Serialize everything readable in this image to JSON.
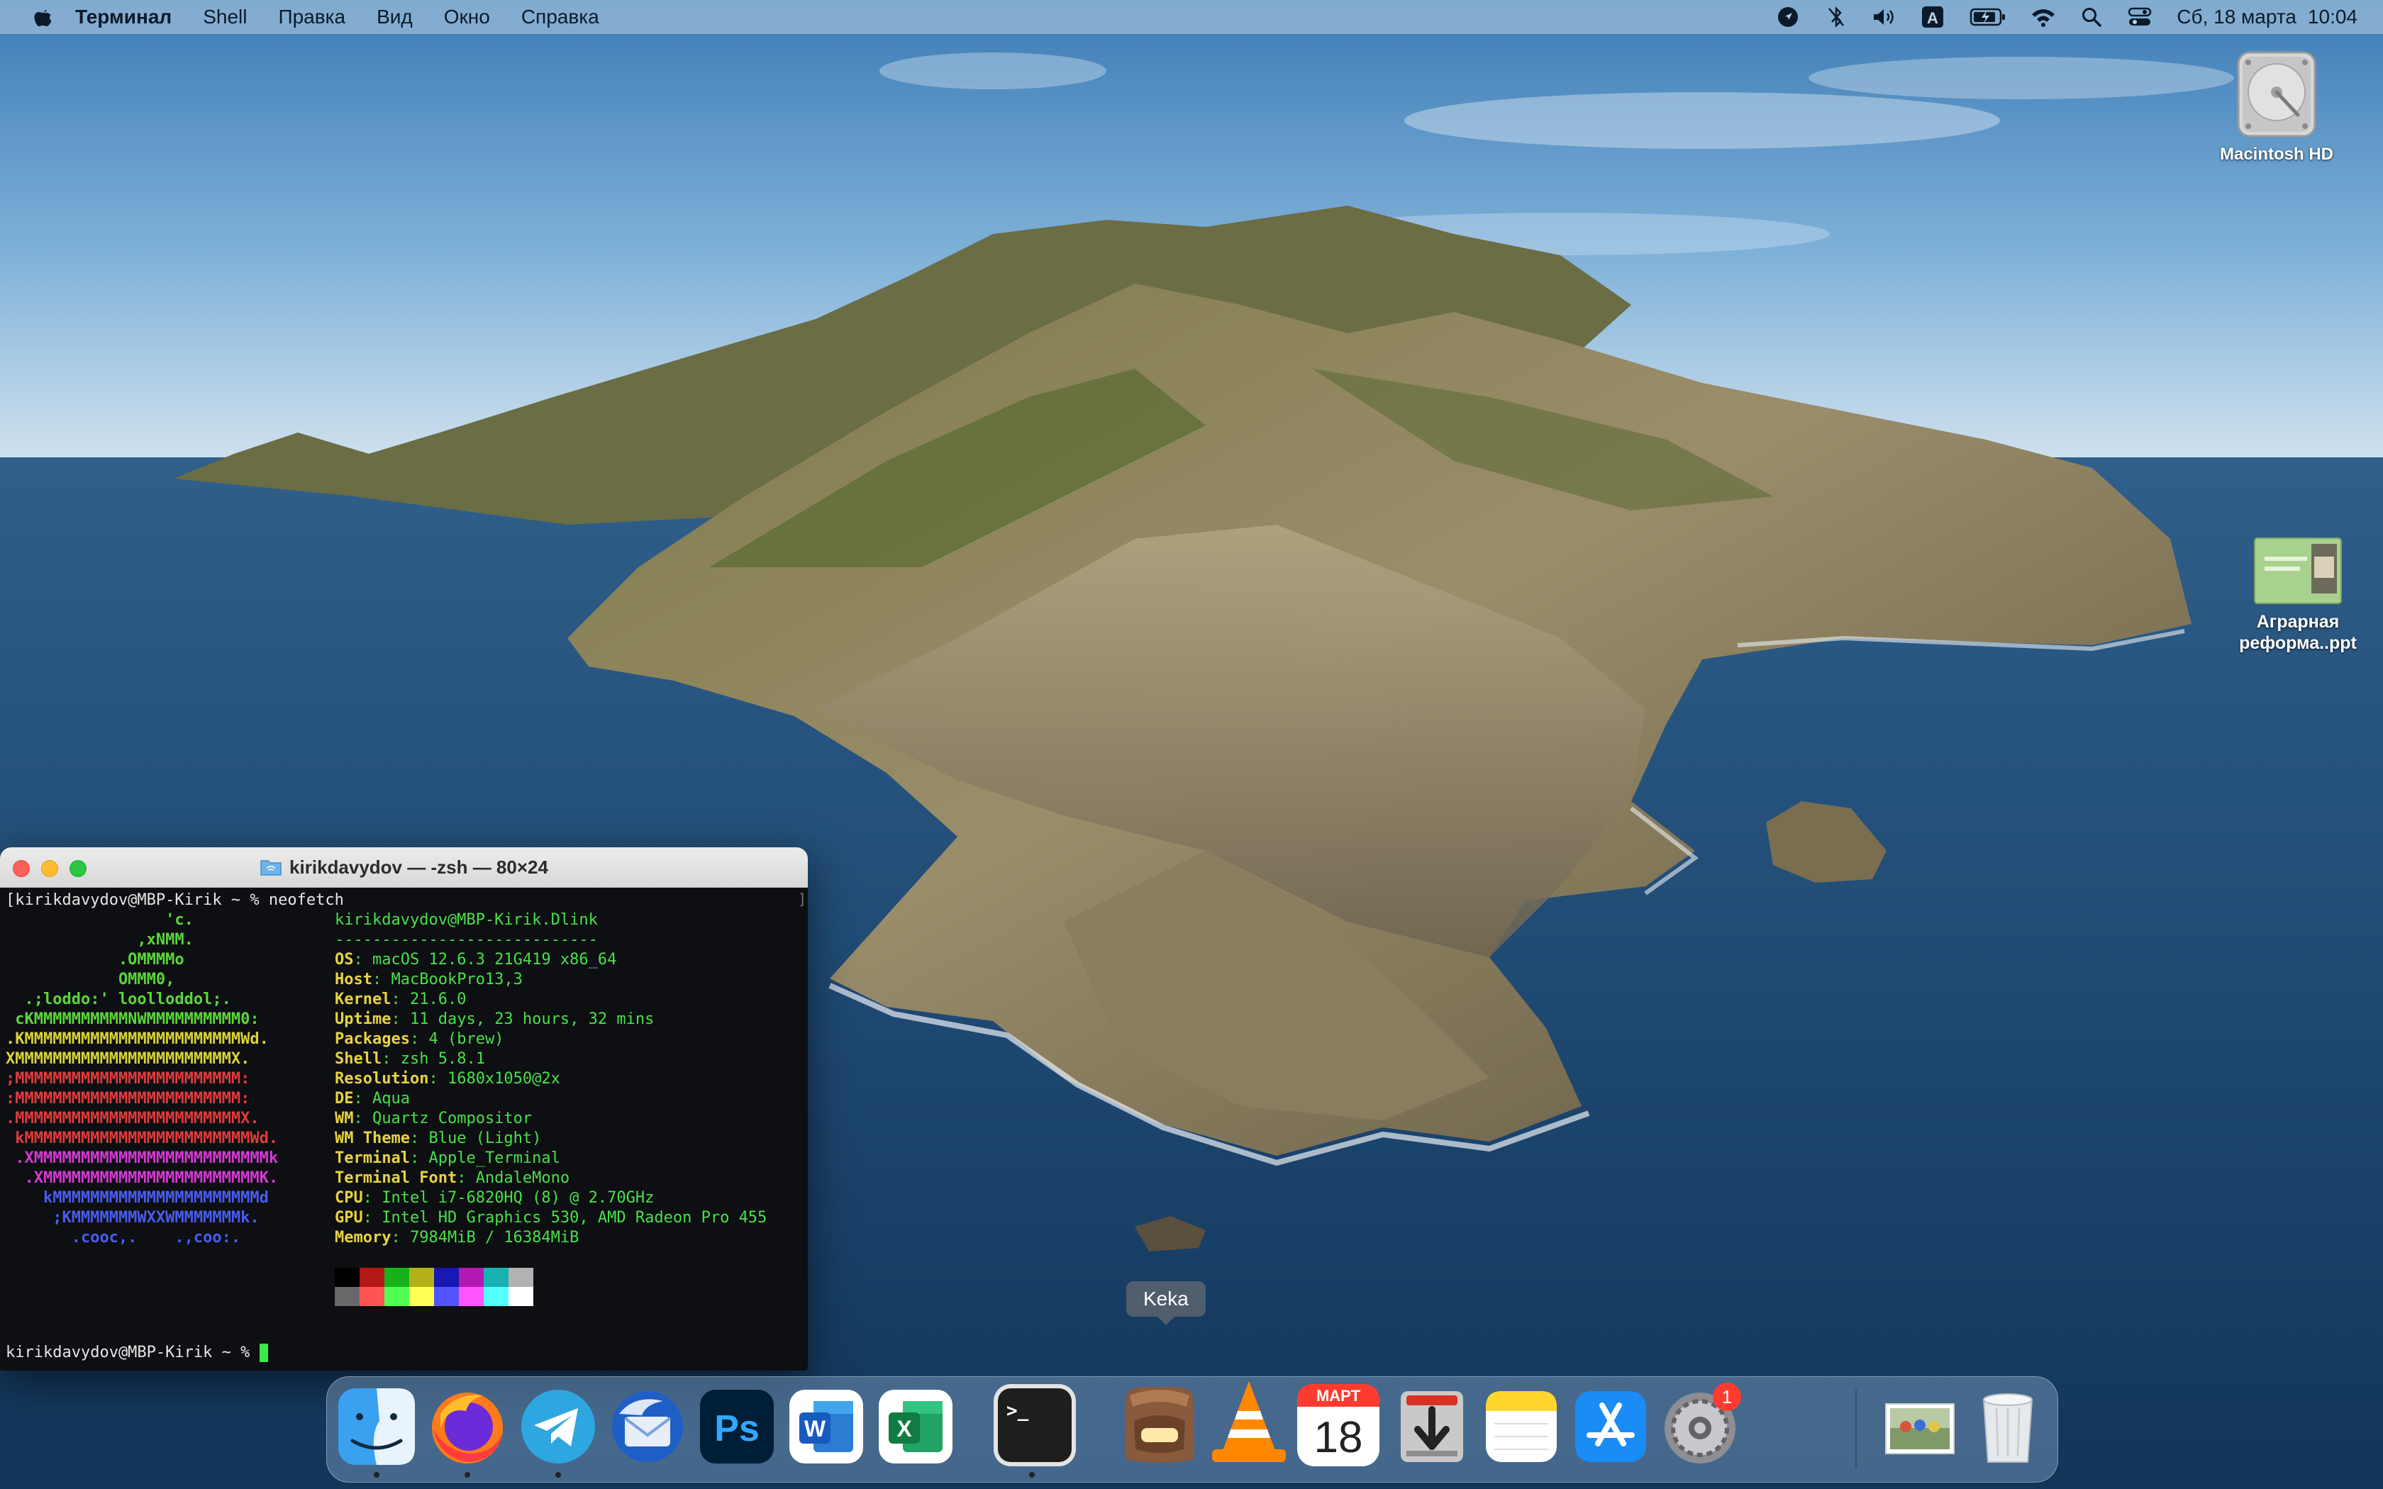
{
  "menubar": {
    "app_name": "Терминал",
    "items": [
      "Shell",
      "Правка",
      "Вид",
      "Окно",
      "Справка"
    ],
    "date": "Сб, 18 марта",
    "time": "10:04",
    "input_source": "A"
  },
  "desktop": {
    "icons": [
      {
        "label": "Macintosh HD",
        "icon": "hard-drive-icon"
      },
      {
        "label_line1": "Аграрная",
        "label_line2": "реформа..ppt",
        "icon": "ppt-document-icon"
      }
    ]
  },
  "terminal": {
    "title": "kirikdavydov — -zsh — 80×24",
    "prompt_line": "[kirikdavydov@MBP-Kirik ~ % neofetch",
    "scroll_marker": "]",
    "final_prompt": "kirikdavydov@MBP-Kirik ~ % ",
    "logo": [
      {
        "text": "                 'c.",
        "color": "#5bd63b"
      },
      {
        "text": "              ,xNMM.",
        "color": "#5bd63b"
      },
      {
        "text": "            .OMMMMo",
        "color": "#5bd63b"
      },
      {
        "text": "            OMMM0,",
        "color": "#5bd63b"
      },
      {
        "text": "  .;loddo:' loolloddol;.",
        "color": "#5bd63b"
      },
      {
        "text": " cKMMMMMMMMMMNWMMMMMMMMMM0:",
        "color": "#5bd63b"
      },
      {
        "text": ".KMMMMMMMMMMMMMMMMMMMMMMMWd.",
        "color": "#d9d337"
      },
      {
        "text": "XMMMMMMMMMMMMMMMMMMMMMMMX.",
        "color": "#d9d337"
      },
      {
        "text": ";MMMMMMMMMMMMMMMMMMMMMMMM:",
        "color": "#e23b3b"
      },
      {
        "text": ":MMMMMMMMMMMMMMMMMMMMMMMM:",
        "color": "#e23b3b"
      },
      {
        "text": ".MMMMMMMMMMMMMMMMMMMMMMMMX.",
        "color": "#e23b3b"
      },
      {
        "text": " kMMMMMMMMMMMMMMMMMMMMMMMMWd.",
        "color": "#e23b3b"
      },
      {
        "text": " .XMMMMMMMMMMMMMMMMMMMMMMMMMk",
        "color": "#d43ad4"
      },
      {
        "text": "  .XMMMMMMMMMMMMMMMMMMMMMMMK.",
        "color": "#d43ad4"
      },
      {
        "text": "    kMMMMMMMMMMMMMMMMMMMMMMd",
        "color": "#4a5cf0"
      },
      {
        "text": "     ;KMMMMMMMWXXWMMMMMMMk.",
        "color": "#4a5cf0"
      },
      {
        "text": "       .cooc,.    .,coo:.",
        "color": "#4a5cf0"
      }
    ],
    "user_host": "kirikdavydov@MBP-Kirik.Dlink",
    "separator": "----------------------------",
    "info": [
      {
        "key": "OS",
        "value": "macOS 12.6.3 21G419 x86_64"
      },
      {
        "key": "Host",
        "value": "MacBookPro13,3"
      },
      {
        "key": "Kernel",
        "value": "21.6.0"
      },
      {
        "key": "Uptime",
        "value": "11 days, 23 hours, 32 mins"
      },
      {
        "key": "Packages",
        "value": "4 (brew)"
      },
      {
        "key": "Shell",
        "value": "zsh 5.8.1"
      },
      {
        "key": "Resolution",
        "value": "1680x1050@2x"
      },
      {
        "key": "DE",
        "value": "Aqua"
      },
      {
        "key": "WM",
        "value": "Quartz Compositor"
      },
      {
        "key": "WM Theme",
        "value": "Blue (Light)"
      },
      {
        "key": "Terminal",
        "value": "Apple_Terminal"
      },
      {
        "key": "Terminal Font",
        "value": "AndaleMono"
      },
      {
        "key": "CPU",
        "value": "Intel i7-6820HQ (8) @ 2.70GHz"
      },
      {
        "key": "GPU",
        "value": "Intel HD Graphics 530, AMD Radeon Pro 455"
      },
      {
        "key": "Memory",
        "value": "7984MiB / 16384MiB"
      }
    ],
    "palette_top": [
      "#000000",
      "#b21818",
      "#18b218",
      "#b2b218",
      "#1818b2",
      "#b218b2",
      "#18b2b2",
      "#b2b2b2"
    ],
    "palette_bottom": [
      "#686868",
      "#ff5454",
      "#54ff54",
      "#ffff54",
      "#5454ff",
      "#ff54ff",
      "#54ffff",
      "#ffffff"
    ]
  },
  "dock": {
    "tooltip": "Keka",
    "calendar_month": "МАРТ",
    "calendar_day": "18",
    "settings_badge": "1",
    "items": [
      {
        "name": "finder-icon",
        "running": true
      },
      {
        "name": "firefox-icon",
        "running": true
      },
      {
        "name": "telegram-icon",
        "running": true
      },
      {
        "name": "thunderbird-icon",
        "running": false
      },
      {
        "name": "photoshop-icon",
        "running": false
      },
      {
        "name": "word-icon",
        "running": false
      },
      {
        "name": "excel-icon",
        "running": false
      },
      {
        "name": "terminal-icon",
        "running": true
      },
      {
        "name": "keka-icon",
        "running": false
      },
      {
        "name": "vlc-icon",
        "running": false
      },
      {
        "name": "calendar-icon",
        "running": false
      },
      {
        "name": "transmission-icon",
        "running": false
      },
      {
        "name": "notes-icon",
        "running": false
      },
      {
        "name": "app-store-icon",
        "running": false
      },
      {
        "name": "system-preferences-icon",
        "running": false
      },
      {
        "name": "recent-photos-stack-icon",
        "running": false
      },
      {
        "name": "trash-icon",
        "running": false
      }
    ]
  }
}
